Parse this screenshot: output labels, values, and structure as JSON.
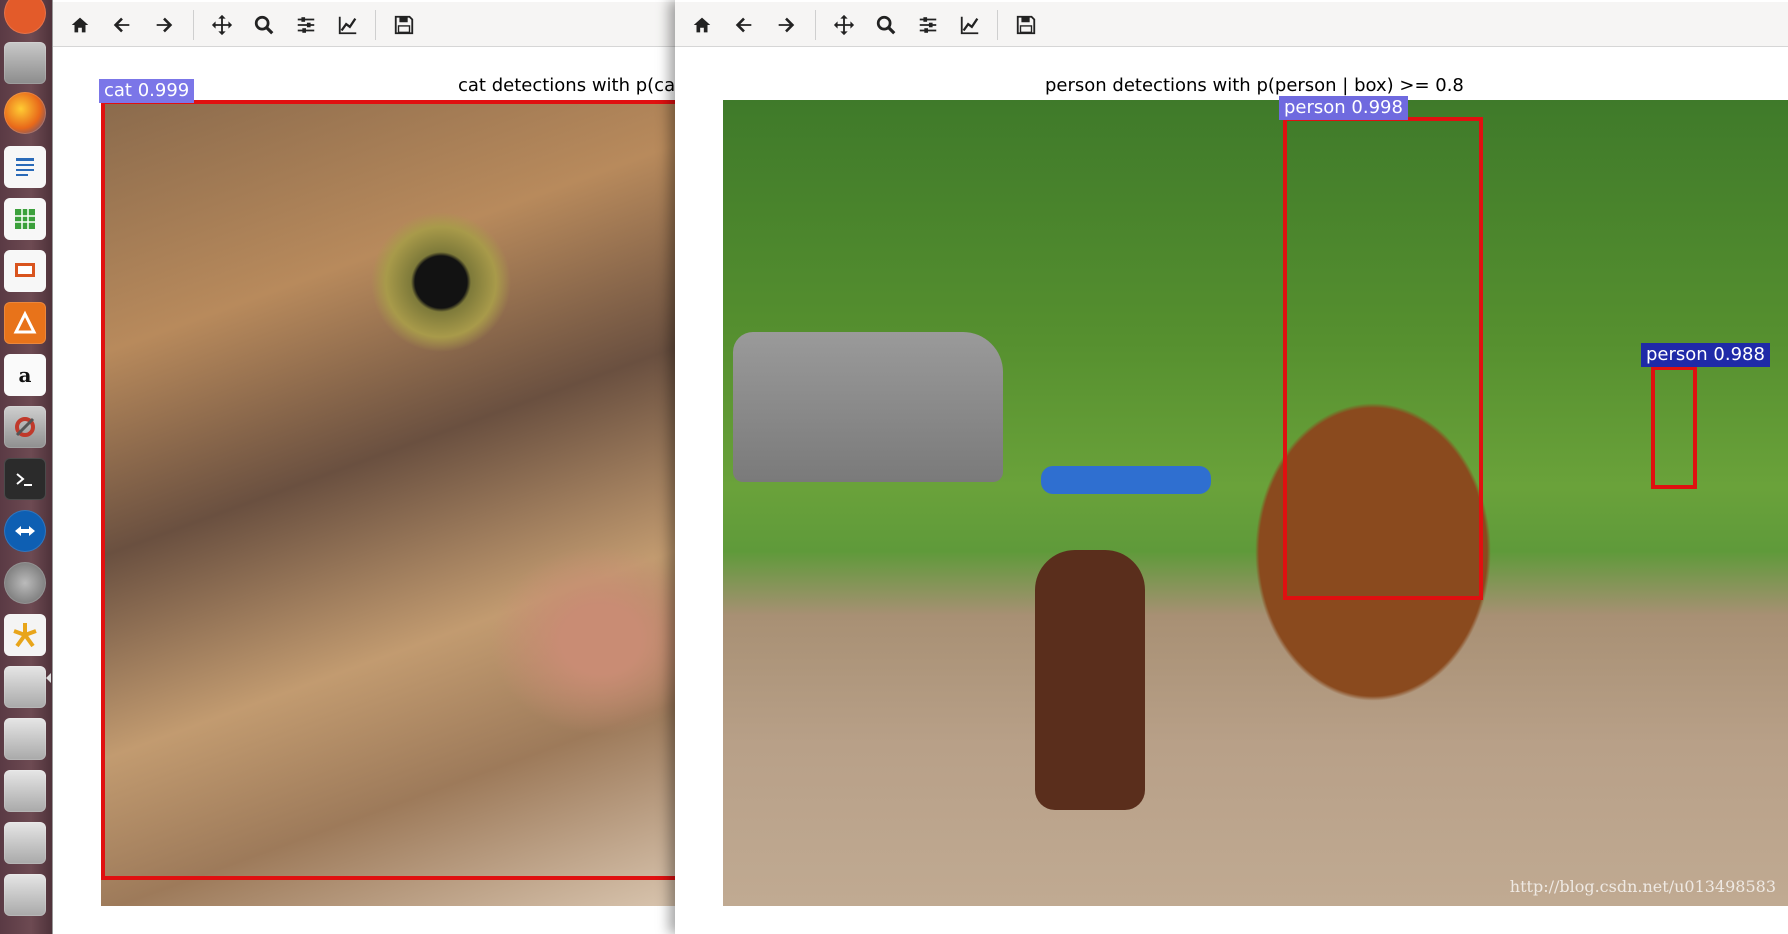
{
  "left_window": {
    "title": "cat detections with p(ca",
    "detections": [
      {
        "label": "cat 0.999"
      }
    ]
  },
  "right_window": {
    "title": "person detections with p(person | box) >= 0.8",
    "detections": [
      {
        "label": "person 0.998"
      },
      {
        "label": "person 0.988"
      }
    ]
  },
  "toolbar_icons": [
    "home-icon",
    "back-arrow-icon",
    "forward-arrow-icon",
    "pan-icon",
    "zoom-icon",
    "configure-subplots-icon",
    "edit-axis-icon",
    "save-icon"
  ],
  "colors": {
    "box": "#e01010",
    "cat_label_bg": "#7b76e8",
    "person_label_bg_1": "#6f6adf",
    "person_label_bg_2": "#1f2aa8"
  },
  "watermark": "http://blog.csdn.net/u013498583",
  "launcher": {
    "items": [
      "ubuntu-dash-icon",
      "files-icon",
      "firefox-icon",
      "writer-icon",
      "calc-icon",
      "impress-icon",
      "software-center-icon",
      "amazon-icon",
      "settings-icon",
      "terminal-icon",
      "teamviewer-icon",
      "updater-icon",
      "app-icon",
      "drive-icon",
      "drive-icon",
      "drive-icon",
      "drive-icon"
    ]
  }
}
